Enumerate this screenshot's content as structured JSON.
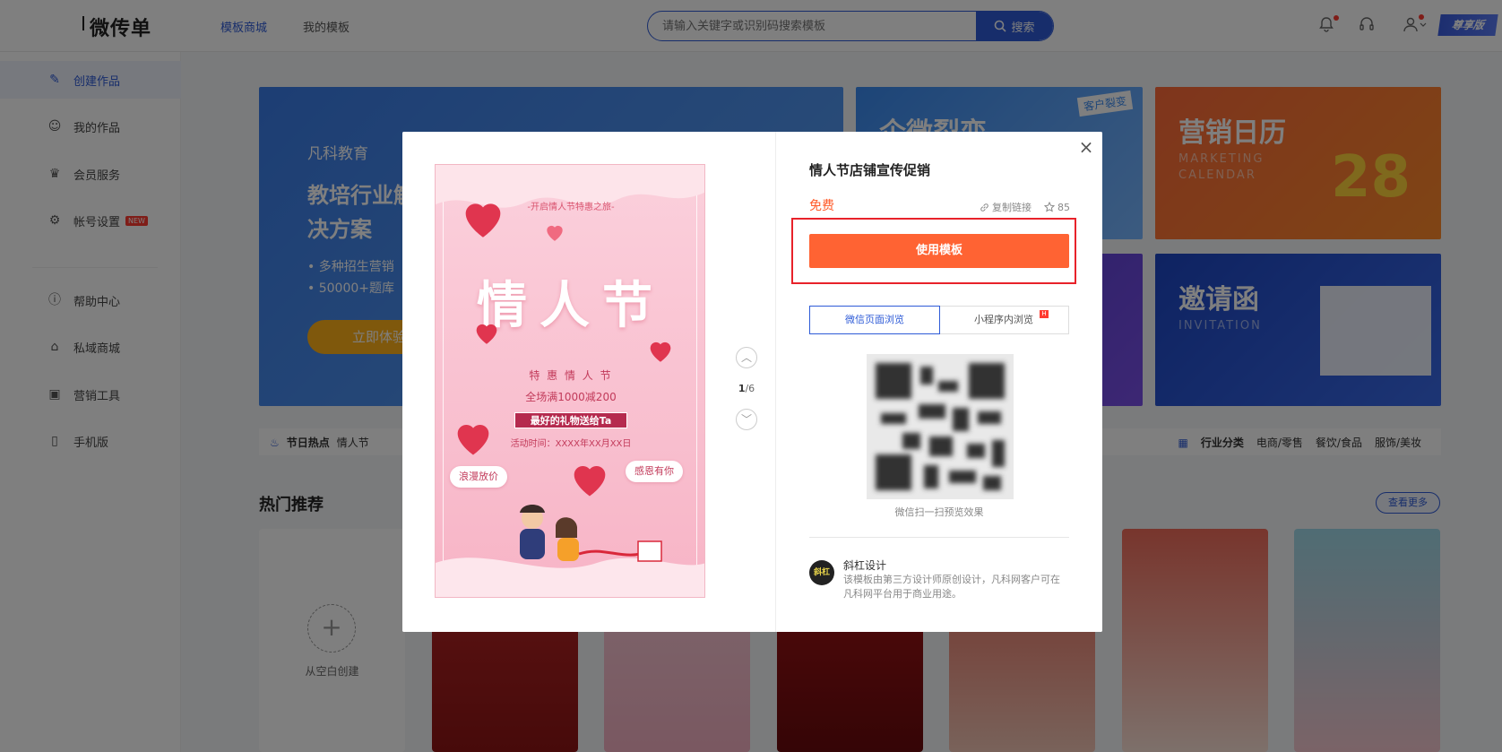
{
  "header": {
    "logo": "微传单",
    "nav": [
      {
        "label": "模板商城",
        "active": true
      },
      {
        "label": "我的模板",
        "active": false
      }
    ],
    "search": {
      "placeholder": "请输入关键字或识别码搜索模板",
      "button_label": "搜索"
    },
    "icons": [
      "bell-icon",
      "headset-icon",
      "user-icon"
    ],
    "vip_label": "尊享版",
    "accent_color": "#2e5bd7"
  },
  "sidebar": {
    "items": [
      {
        "label": "创建作品",
        "icon": "edit-icon",
        "active": true
      },
      {
        "label": "我的作品",
        "icon": "user-icon"
      },
      {
        "label": "会员服务",
        "icon": "crown-icon"
      },
      {
        "label": "帐号设置",
        "icon": "settings-icon",
        "badge": "NEW"
      },
      {
        "label": "帮助中心",
        "icon": "help-icon"
      },
      {
        "label": "私域商城",
        "icon": "shop-icon"
      },
      {
        "label": "营销工具",
        "icon": "toolbox-icon"
      },
      {
        "label": "手机版",
        "icon": "mobile-icon"
      }
    ]
  },
  "background": {
    "main_banner": {
      "brand": "凡科教育",
      "title": "教培行业解决方案",
      "bullets": [
        "多种招生营销",
        "50000+题库"
      ],
      "cta": "立即体验"
    },
    "tiles": [
      {
        "title": "企微裂变",
        "tag": "客户裂变"
      },
      {
        "title": "营销日历",
        "sub": "MARKETING CALENDAR",
        "number": "28"
      },
      {
        "title": "邀请函",
        "sub": "INVITATION"
      }
    ],
    "hot_bar": {
      "left_label": "节日热点",
      "left_items": [
        "情人节"
      ],
      "right_label": "行业分类",
      "right_items": [
        "电商/零售",
        "餐饮/食品",
        "服饰/美妆"
      ]
    },
    "section_title": "热门推荐",
    "see_more": "查看更多",
    "blank_create": "从空白创建"
  },
  "modal": {
    "title": "情人节店铺宣传促销",
    "price": "免费",
    "copy_link": "复制链接",
    "favorites": "85",
    "use_button": "使用模板",
    "tabs": [
      {
        "label": "微信页面浏览",
        "active": true
      },
      {
        "label": "小程序内浏览",
        "hot": true
      }
    ],
    "qr_caption": "微信扫一扫预览效果",
    "designer": {
      "avatar_text": "斜杠",
      "name": "斜杠设计",
      "desc": "该模板由第三方设计师原创设计，凡科网客户可在凡科网平台用于商业用途。"
    },
    "pager": {
      "current": "1",
      "total": "/6"
    },
    "poster": {
      "subtitle": "-开启情人节特惠之旅-",
      "title": "情人节",
      "line1": "特 惠 情 人 节",
      "line2": "全场满1000减200",
      "highlight": "最好的礼物送给Ta",
      "date": "活动时间：XXXX年XX月XX日",
      "cloud_left": "浪漫放价",
      "cloud_right": "感恩有你"
    },
    "primary_color": "#ff6333",
    "highlight_box_color": "#e8222a"
  }
}
